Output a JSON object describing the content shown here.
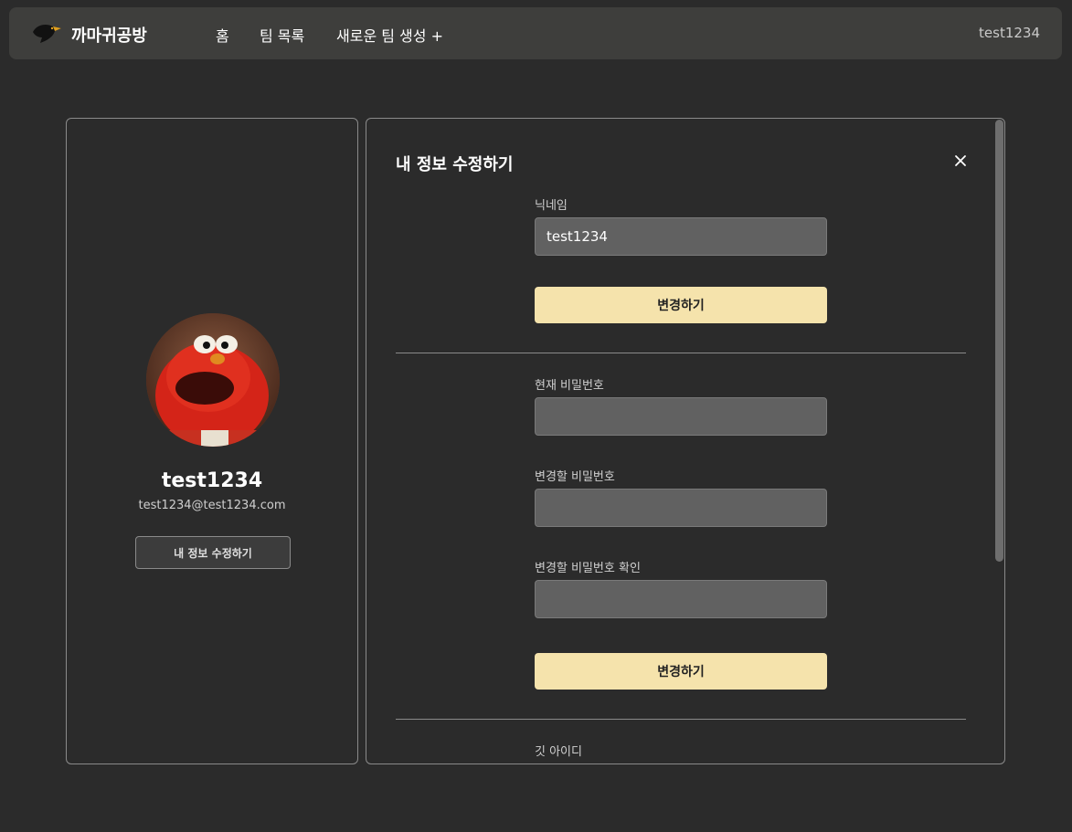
{
  "header": {
    "brand": "까마귀공방",
    "logo_icon": "crow-icon",
    "nav": {
      "home": "홈",
      "teams": "팀 목록",
      "new_team": "새로운 팀 생성 +"
    },
    "user": "test1234"
  },
  "profile": {
    "name": "test1234",
    "email": "test1234@test1234.com",
    "edit_button": "내 정보 수정하기",
    "avatar_icon": "avatar-image"
  },
  "edit_panel": {
    "title": "내 정보 수정하기",
    "close_icon": "close-icon",
    "nickname": {
      "label": "닉네임",
      "value": "test1234",
      "submit": "변경하기"
    },
    "password": {
      "current_label": "현재 비밀번호",
      "new_label": "변경할 비밀번호",
      "confirm_label": "변경할 비밀번호 확인",
      "submit": "변경하기"
    },
    "git": {
      "label": "깃 아이디"
    }
  },
  "colors": {
    "background": "#2b2b2b",
    "navbar": "#3e3e3c",
    "accent_button": "#f5e3ac",
    "input_bg": "#616161"
  }
}
